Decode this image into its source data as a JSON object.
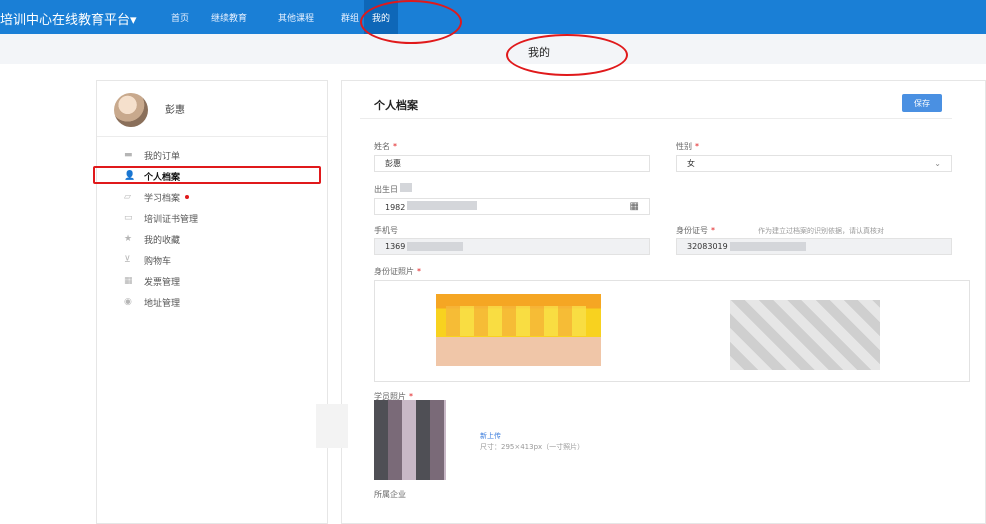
{
  "topnav": {
    "brand": "培训中心在线教育平台▾",
    "items": [
      "首页",
      "继续教育",
      "其他课程",
      "群组",
      "我的"
    ]
  },
  "page": {
    "subtitle": "我的"
  },
  "sidebar": {
    "username": "彭惠",
    "items": [
      {
        "label": "我的订单",
        "icon": "order-icon"
      },
      {
        "label": "个人档案",
        "icon": "user-icon"
      },
      {
        "label": "学习档案",
        "icon": "study-icon"
      },
      {
        "label": "培训证书管理",
        "icon": "certificate-icon"
      },
      {
        "label": "我的收藏",
        "icon": "star-icon"
      },
      {
        "label": "购物车",
        "icon": "cart-icon"
      },
      {
        "label": "发票管理",
        "icon": "invoice-icon"
      },
      {
        "label": "地址管理",
        "icon": "location-icon"
      }
    ]
  },
  "profile": {
    "title": "个人档案",
    "save_label": "保存",
    "name_label": "姓名",
    "name_value": "彭惠",
    "gender_label": "性别",
    "gender_value": "女",
    "birth_label": "出生日",
    "birth_value": "1982",
    "phone_label": "手机号",
    "phone_value": "1369",
    "id_label": "身份证号",
    "id_hint": "作为建立过档案的识别依据，请认真核对",
    "id_value": "32083019",
    "id_photo_label": "身份证照片",
    "student_photo_label": "学员照片",
    "upload_label": "新上传",
    "size_hint": "尺寸：295×413px（一寸照片）",
    "company_label": "所属企业"
  },
  "colors": {
    "topbar": "#1a7fd6",
    "accent": "#4a90e2",
    "annotation": "#e0191b"
  }
}
